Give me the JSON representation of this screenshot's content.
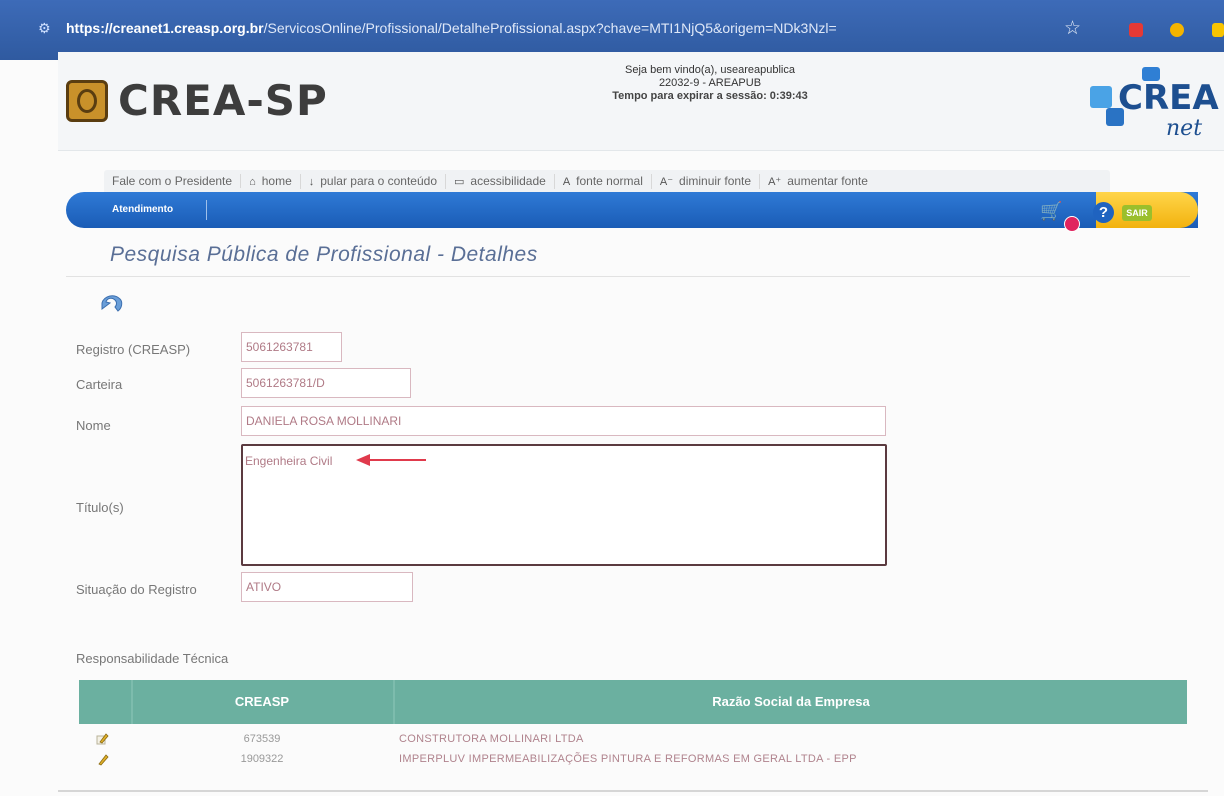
{
  "browser": {
    "url_host": "https://creanet1.creasp.org.br",
    "url_path": "/ServicosOnline/Profissional/DetalheProfissional.aspx?chave=MTI1NjQ5&origem=NDk3Nzl="
  },
  "header": {
    "logo_text": "CREA-SP",
    "welcome": "Seja bem vindo(a), useareapublica",
    "user_code": "22032-9 - AREAPUB",
    "session_timer": "Tempo para expirar a sessão: 0:39:43",
    "crea_net_logo_text": "CREA",
    "crea_net_logo_sub": "net"
  },
  "quicklinks": [
    {
      "icon": "",
      "label": "Fale com o Presidente"
    },
    {
      "icon": "home-icon",
      "label": "home"
    },
    {
      "icon": "down-arrow-icon",
      "label": "pular para o conteúdo"
    },
    {
      "icon": "accessibility-icon",
      "label": "acessibilidade"
    },
    {
      "icon": "font-normal-icon",
      "label": "fonte normal"
    },
    {
      "icon": "font-decrease-icon",
      "label": "diminuir fonte"
    },
    {
      "icon": "font-increase-icon",
      "label": "aumentar fonte"
    }
  ],
  "menubar": {
    "item": "Atendimento",
    "sair": "SAIR"
  },
  "page": {
    "title": "Pesquisa Pública de Profissional - Detalhes"
  },
  "form": {
    "registro_label": "Registro (CREASP)",
    "registro_value": "5061263781",
    "carteira_label": "Carteira",
    "carteira_value": "5061263781/D",
    "nome_label": "Nome",
    "nome_value": "DANIELA ROSA MOLLINARI",
    "titulo_label": "Título(s)",
    "titulo_value": "Engenheira Civil",
    "situacao_label": "Situação do Registro",
    "situacao_value": "ATIVO"
  },
  "responsabilidade": {
    "label": "Responsabilidade Técnica",
    "columns": [
      "CREASP",
      "Razão Social da Empresa"
    ],
    "rows": [
      {
        "creasp": "673539",
        "razao": "CONSTRUTORA MOLLINARI LTDA"
      },
      {
        "creasp": "1909322",
        "razao": "IMPERPLUV IMPERMEABILIZAÇÕES PINTURA E REFORMAS EM GERAL LTDA - EPP"
      }
    ]
  },
  "colors": {
    "menubar_blue": "#1a5cb6",
    "table_header": "#6bb0a0",
    "title_text": "#5a6f96",
    "annotation_arrow": "#e03a4c"
  }
}
